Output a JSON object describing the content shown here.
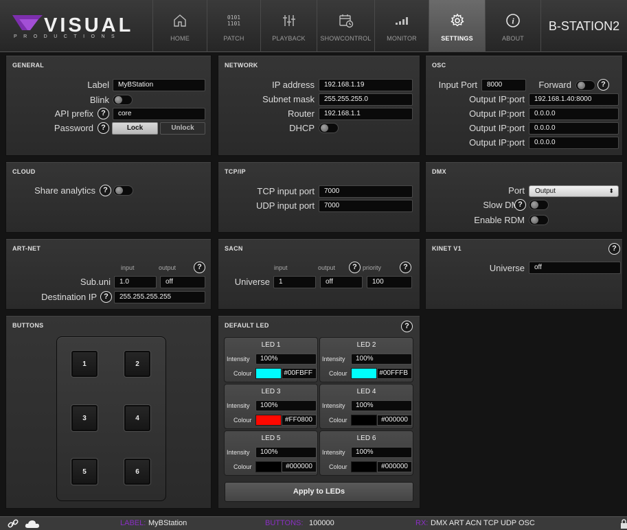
{
  "logo": {
    "name": "VISUAL",
    "subtitle": "PRODUCTIONS"
  },
  "nav": {
    "home": "HOME",
    "patch": "PATCH",
    "patch_icon_text": "0101\n1101",
    "playback": "PLAYBACK",
    "showcontrol": "SHOWCONTROL",
    "monitor": "MONITOR",
    "settings": "SETTINGS",
    "about": "ABOUT",
    "active": "settings"
  },
  "device_name": "B-STATION2",
  "general": {
    "title": "GENERAL",
    "label_label": "Label",
    "label_value": "MyBStation",
    "blink_label": "Blink",
    "blink_on": false,
    "api_prefix_label": "API prefix",
    "api_prefix_value": "core",
    "password_label": "Password",
    "lock_label": "Lock",
    "unlock_label": "Unlock"
  },
  "network": {
    "title": "NETWORK",
    "ip_label": "IP address",
    "ip_value": "192.168.1.19",
    "subnet_label": "Subnet mask",
    "subnet_value": "255.255.255.0",
    "router_label": "Router",
    "router_value": "192.168.1.1",
    "dhcp_label": "DHCP",
    "dhcp_on": false
  },
  "osc": {
    "title": "OSC",
    "input_port_label": "Input Port",
    "input_port_value": "8000",
    "forward_label": "Forward",
    "forward_on": false,
    "outputs": [
      {
        "label": "Output IP:port",
        "value": "192.168.1.40:8000"
      },
      {
        "label": "Output IP:port",
        "value": "0.0.0.0"
      },
      {
        "label": "Output IP:port",
        "value": "0.0.0.0"
      },
      {
        "label": "Output IP:port",
        "value": "0.0.0.0"
      }
    ]
  },
  "cloud": {
    "title": "CLOUD",
    "share_label": "Share analytics",
    "share_on": false
  },
  "tcpip": {
    "title": "TCP/IP",
    "tcp_label": "TCP input port",
    "tcp_value": "7000",
    "udp_label": "UDP input port",
    "udp_value": "7000"
  },
  "dmx": {
    "title": "DMX",
    "port_label": "Port",
    "port_value": "Output",
    "slow_label": "Slow DMX",
    "slow_on": false,
    "rdm_label": "Enable RDM",
    "rdm_on": false
  },
  "artnet": {
    "title": "ART-NET",
    "input_header": "input",
    "output_header": "output",
    "subuni_label": "Sub.uni",
    "subuni_input": "1.0",
    "subuni_output": "off",
    "dest_label": "Destination IP",
    "dest_value": "255.255.255.255"
  },
  "sacn": {
    "title": "SACN",
    "input_header": "input",
    "output_header": "output",
    "priority_header": "priority",
    "universe_label": "Universe",
    "universe_input": "1",
    "universe_output": "off",
    "priority_value": "100"
  },
  "kinet": {
    "title": "KINET V1",
    "universe_label": "Universe",
    "universe_value": "off"
  },
  "buttons": {
    "title": "BUTTONS",
    "keys": [
      "1",
      "2",
      "3",
      "4",
      "5",
      "6"
    ]
  },
  "default_led": {
    "title": "DEFAULT LED",
    "intensity_label": "Intensity",
    "colour_label": "Colour",
    "apply_label": "Apply to LEDs",
    "leds": [
      {
        "name": "LED 1",
        "intensity": "100%",
        "hex": "#00FBFF",
        "color": "#00FBFF"
      },
      {
        "name": "LED 2",
        "intensity": "100%",
        "hex": "#00FFFB",
        "color": "#00FFFB"
      },
      {
        "name": "LED 3",
        "intensity": "100%",
        "hex": "#FF0800",
        "color": "#FF0800"
      },
      {
        "name": "LED 4",
        "intensity": "100%",
        "hex": "#000000",
        "color": "#000000"
      },
      {
        "name": "LED 5",
        "intensity": "100%",
        "hex": "#000000",
        "color": "#000000"
      },
      {
        "name": "LED 6",
        "intensity": "100%",
        "hex": "#000000",
        "color": "#000000"
      }
    ]
  },
  "help_glyph": "?",
  "status": {
    "label_key": "LABEL:",
    "label_value": "MyBStation",
    "buttons_key": "BUTTONS:",
    "buttons_value": "100000",
    "rx_key": "RX:",
    "rx_value": "DMX ART ACN TCP UDP OSC"
  },
  "colors": {
    "accent": "#8a2fc4",
    "panel": "#2f2f2f",
    "field": "#0a0a0a"
  }
}
